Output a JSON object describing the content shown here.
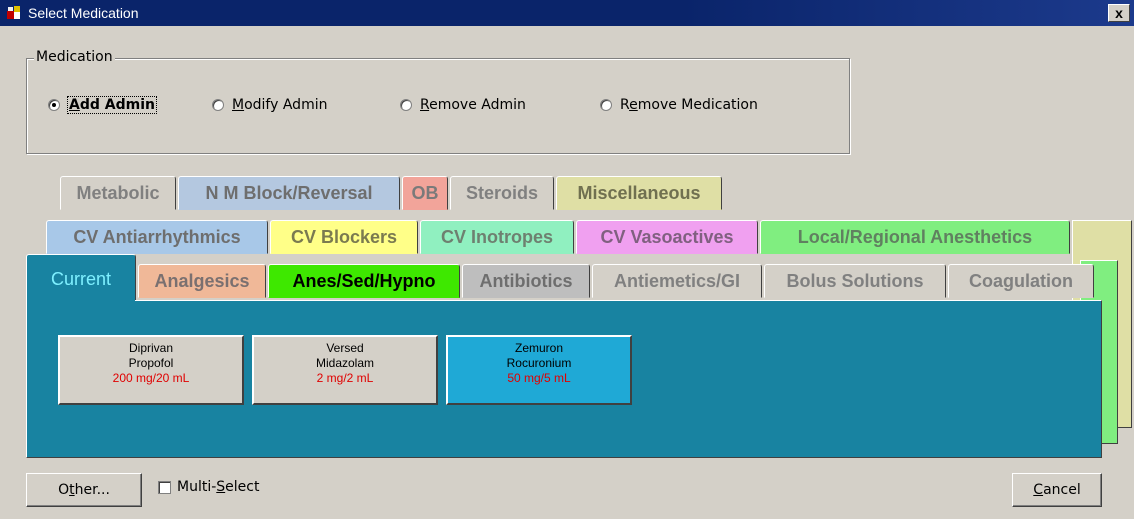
{
  "window": {
    "title": "Select Medication",
    "close_label": "x"
  },
  "medication_group": {
    "legend": "Medication",
    "options": [
      {
        "pre": "",
        "key": "A",
        "post": "dd Admin",
        "selected": true
      },
      {
        "pre": "",
        "key": "M",
        "post": "odify Admin",
        "selected": false
      },
      {
        "pre": "",
        "key": "R",
        "post": "emove Admin",
        "selected": false
      },
      {
        "pre": "R",
        "key": "e",
        "post": "move Medication",
        "selected": false
      }
    ]
  },
  "tabs": {
    "row1": [
      {
        "label": "Metabolic",
        "bg": "#d4d0c8",
        "fg": "#808080",
        "bold": true
      },
      {
        "label": "N M Block/Reversal",
        "bg": "#b4c8e0",
        "fg": "#6e6e6e",
        "bold": true
      },
      {
        "label": "OB",
        "bg": "#f2a49a",
        "fg": "#7a7a7a",
        "bold": true
      },
      {
        "label": "Steroids",
        "bg": "#d4d0c8",
        "fg": "#808080",
        "bold": true
      },
      {
        "label": "Miscellaneous",
        "bg": "#dfdfa5",
        "fg": "#707050",
        "bold": true
      }
    ],
    "row2": [
      {
        "label": "CV Antiarrhythmics",
        "bg": "#a8c8e8",
        "fg": "#6e6e6e",
        "bold": true
      },
      {
        "label": "CV Blockers",
        "bg": "#ffff88",
        "fg": "#7a7a50",
        "bold": true
      },
      {
        "label": "CV Inotropes",
        "bg": "#90f0c0",
        "fg": "#6e8070",
        "bold": true
      },
      {
        "label": "CV Vasoactives",
        "bg": "#f0a0f0",
        "fg": "#806080",
        "bold": true
      },
      {
        "label": "Local/Regional Anesthetics",
        "bg": "#80ee80",
        "fg": "#608060",
        "bold": true
      }
    ],
    "row3": [
      {
        "label": "Current",
        "bg": "#1883a1",
        "fg": "#7ef0ff",
        "bold": false
      },
      {
        "label": "Analgesics",
        "bg": "#f0b898",
        "fg": "#7a7070",
        "bold": true
      },
      {
        "label": "Anes/Sed/Hypno",
        "bg": "#3ee800",
        "fg": "#000000",
        "bold": true
      },
      {
        "label": "Antibiotics",
        "bg": "#bebebe",
        "fg": "#6e6e6e",
        "bold": true
      },
      {
        "label": "Antiemetics/GI",
        "bg": "#d4d0c8",
        "fg": "#808080",
        "bold": true
      },
      {
        "label": "Bolus Solutions",
        "bg": "#d4d0c8",
        "fg": "#808080",
        "bold": true
      },
      {
        "label": "Coagulation",
        "bg": "#d4d0c8",
        "fg": "#808080",
        "bold": true
      }
    ]
  },
  "medications": [
    {
      "brand": "Diprivan",
      "generic": "Propofol",
      "dose": "200 mg/20 mL",
      "bg": "#d4d0c8"
    },
    {
      "brand": "Versed",
      "generic": "Midazolam",
      "dose": "2 mg/2 mL",
      "bg": "#d4d0c8"
    },
    {
      "brand": "Zemuron",
      "generic": "Rocuronium",
      "dose": "50 mg/5 mL",
      "bg": "#1fa9d6"
    }
  ],
  "footer": {
    "other_pre": "O",
    "other_key": "t",
    "other_post": "her...",
    "multi_pre": "Multi-",
    "multi_key": "S",
    "multi_post": "elect",
    "multi_checked": false,
    "cancel_key": "C",
    "cancel_post": "ancel"
  }
}
